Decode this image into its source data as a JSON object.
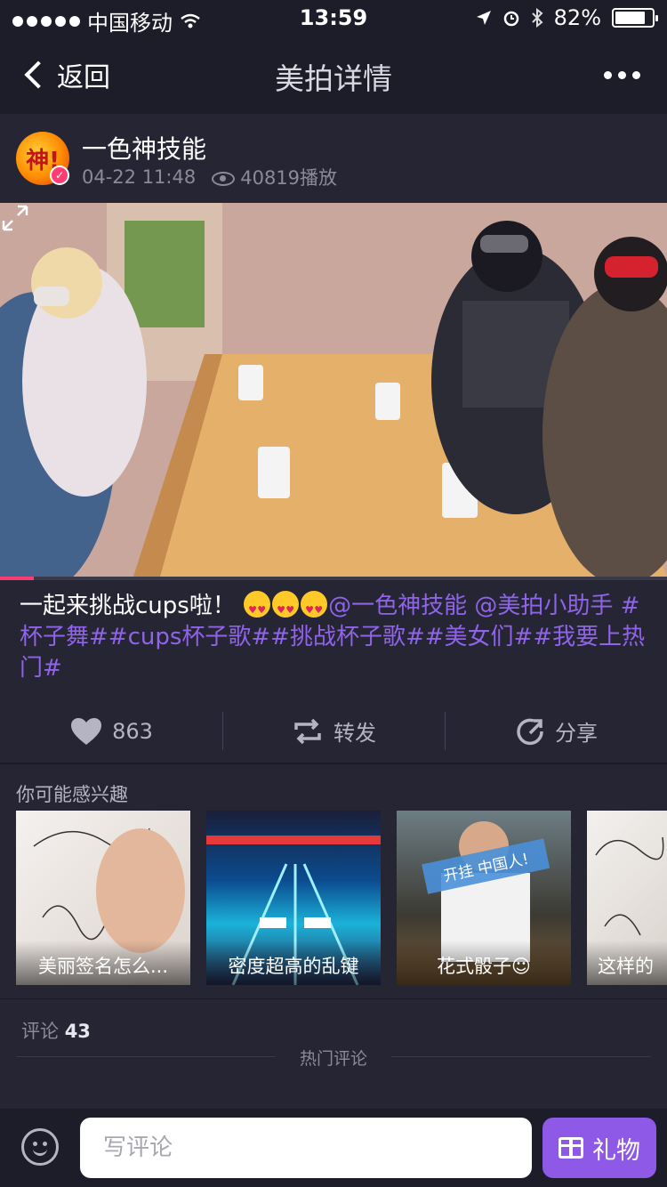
{
  "status_bar": {
    "carrier": "中国移动",
    "time": "13:59",
    "battery": "82%",
    "battery_level": 0.82
  },
  "nav": {
    "back_label": "返回",
    "title": "美拍详情"
  },
  "author": {
    "avatar_text": "神!",
    "name": "一色神技能",
    "date": "04-22 11:48",
    "plays": "40819播放"
  },
  "video": {
    "progress": 0.05
  },
  "caption": {
    "text": "一起来挑战cups啦！",
    "links": "@一色神技能 @美拍小助手 #杯子舞##cups杯子歌##挑战杯子歌##美女们##我要上热门#"
  },
  "actions": {
    "likes": "863",
    "repost": "转发",
    "share": "分享"
  },
  "recommend": {
    "title": "你可能感兴趣",
    "items": [
      {
        "label": "美丽签名怎么..."
      },
      {
        "label": "密度超高的乱键"
      },
      {
        "label": "花式骰子☺",
        "banner": "开挂 中国人!"
      },
      {
        "label": "这样的字"
      }
    ]
  },
  "comments": {
    "label": "评论",
    "count": "43",
    "hot_label": "热门评论"
  },
  "bottom": {
    "placeholder": "写评论",
    "gift_label": "礼物"
  },
  "colors": {
    "accent": "#8f59e8",
    "link": "#8f64e8",
    "background": "#262534",
    "bar": "#1d1c29"
  }
}
